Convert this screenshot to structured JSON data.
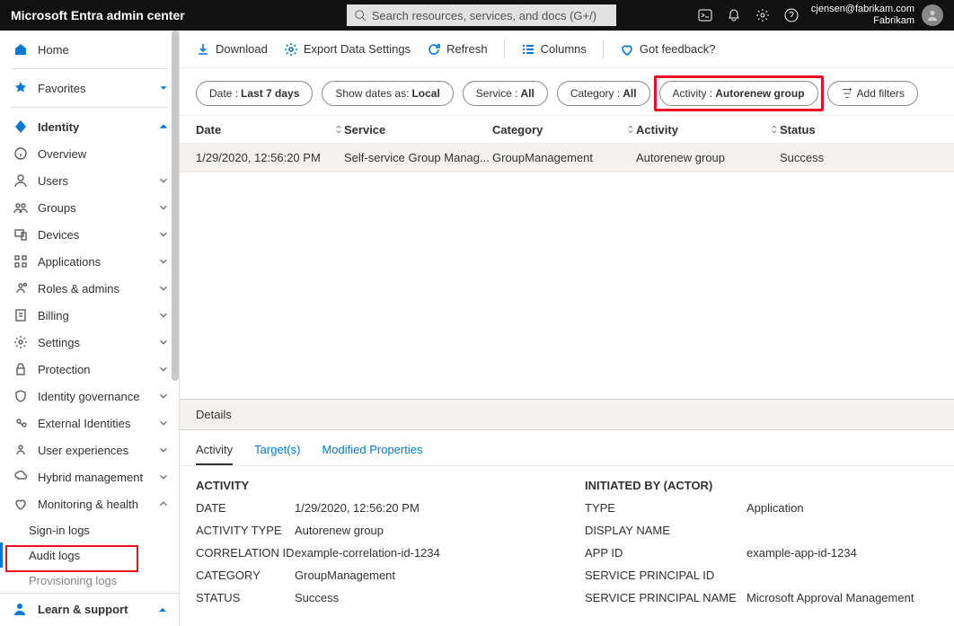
{
  "header": {
    "title": "Microsoft Entra admin center",
    "search_placeholder": "Search resources, services, and docs (G+/)",
    "user_email": "cjensen@fabrikam.com",
    "user_tenant": "Fabrikam"
  },
  "sidebar": {
    "home": "Home",
    "favorites": "Favorites",
    "identity": "Identity",
    "items": [
      "Overview",
      "Users",
      "Groups",
      "Devices",
      "Applications",
      "Roles & admins",
      "Billing",
      "Settings",
      "Protection",
      "Identity governance",
      "External Identities",
      "User experiences",
      "Hybrid management",
      "Monitoring & health"
    ],
    "subs": [
      "Sign-in logs",
      "Audit logs",
      "Provisioning logs"
    ],
    "learn": "Learn & support"
  },
  "cmdbar": {
    "download": "Download",
    "export": "Export Data Settings",
    "refresh": "Refresh",
    "columns": "Columns",
    "feedback": "Got feedback?"
  },
  "filters": {
    "date_label": "Date : ",
    "date_value": "Last 7 days",
    "showdates_label": "Show dates as:  ",
    "showdates_value": "Local",
    "service_label": "Service : ",
    "service_value": "All",
    "category_label": "Category : ",
    "category_value": "All",
    "activity_label": "Activity : ",
    "activity_value": "Autorenew group",
    "add": "Add filters"
  },
  "table": {
    "headers": {
      "date": "Date",
      "service": "Service",
      "category": "Category",
      "activity": "Activity",
      "status": "Status"
    },
    "rows": [
      {
        "date": "1/29/2020, 12:56:20 PM",
        "service": "Self-service Group Manag...",
        "category": "GroupManagement",
        "activity": "Autorenew group",
        "status": "Success"
      }
    ]
  },
  "details": {
    "title": "Details",
    "tabs": [
      "Activity",
      "Target(s)",
      "Modified Properties"
    ],
    "left_heading": "ACTIVITY",
    "right_heading": "INITIATED BY (ACTOR)",
    "left": [
      {
        "k": "DATE",
        "v": "1/29/2020, 12:56:20 PM"
      },
      {
        "k": "ACTIVITY TYPE",
        "v": "Autorenew group"
      },
      {
        "k": "CORRELATION ID",
        "v": "example-correlation-id-1234"
      },
      {
        "k": "CATEGORY",
        "v": "GroupManagement"
      },
      {
        "k": "STATUS",
        "v": "Success"
      }
    ],
    "right": [
      {
        "k": "TYPE",
        "v": "Application"
      },
      {
        "k": "DISPLAY NAME",
        "v": ""
      },
      {
        "k": "APP ID",
        "v": "example-app-id-1234"
      },
      {
        "k": "SERVICE PRINCIPAL ID",
        "v": ""
      },
      {
        "k": "SERVICE PRINCIPAL NAME",
        "v": "Microsoft Approval Management"
      }
    ]
  }
}
